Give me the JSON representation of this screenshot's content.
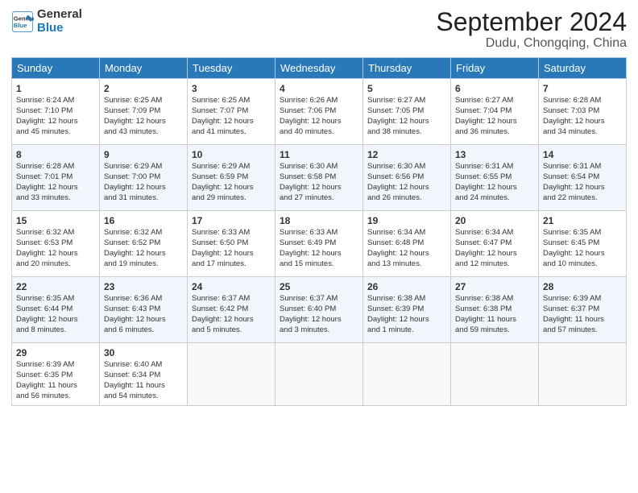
{
  "header": {
    "logo_line1": "General",
    "logo_line2": "Blue",
    "month": "September 2024",
    "location": "Dudu, Chongqing, China"
  },
  "days_of_week": [
    "Sunday",
    "Monday",
    "Tuesday",
    "Wednesday",
    "Thursday",
    "Friday",
    "Saturday"
  ],
  "weeks": [
    [
      {
        "day": 1,
        "details": "Sunrise: 6:24 AM\nSunset: 7:10 PM\nDaylight: 12 hours\nand 45 minutes."
      },
      {
        "day": 2,
        "details": "Sunrise: 6:25 AM\nSunset: 7:09 PM\nDaylight: 12 hours\nand 43 minutes."
      },
      {
        "day": 3,
        "details": "Sunrise: 6:25 AM\nSunset: 7:07 PM\nDaylight: 12 hours\nand 41 minutes."
      },
      {
        "day": 4,
        "details": "Sunrise: 6:26 AM\nSunset: 7:06 PM\nDaylight: 12 hours\nand 40 minutes."
      },
      {
        "day": 5,
        "details": "Sunrise: 6:27 AM\nSunset: 7:05 PM\nDaylight: 12 hours\nand 38 minutes."
      },
      {
        "day": 6,
        "details": "Sunrise: 6:27 AM\nSunset: 7:04 PM\nDaylight: 12 hours\nand 36 minutes."
      },
      {
        "day": 7,
        "details": "Sunrise: 6:28 AM\nSunset: 7:03 PM\nDaylight: 12 hours\nand 34 minutes."
      }
    ],
    [
      {
        "day": 8,
        "details": "Sunrise: 6:28 AM\nSunset: 7:01 PM\nDaylight: 12 hours\nand 33 minutes."
      },
      {
        "day": 9,
        "details": "Sunrise: 6:29 AM\nSunset: 7:00 PM\nDaylight: 12 hours\nand 31 minutes."
      },
      {
        "day": 10,
        "details": "Sunrise: 6:29 AM\nSunset: 6:59 PM\nDaylight: 12 hours\nand 29 minutes."
      },
      {
        "day": 11,
        "details": "Sunrise: 6:30 AM\nSunset: 6:58 PM\nDaylight: 12 hours\nand 27 minutes."
      },
      {
        "day": 12,
        "details": "Sunrise: 6:30 AM\nSunset: 6:56 PM\nDaylight: 12 hours\nand 26 minutes."
      },
      {
        "day": 13,
        "details": "Sunrise: 6:31 AM\nSunset: 6:55 PM\nDaylight: 12 hours\nand 24 minutes."
      },
      {
        "day": 14,
        "details": "Sunrise: 6:31 AM\nSunset: 6:54 PM\nDaylight: 12 hours\nand 22 minutes."
      }
    ],
    [
      {
        "day": 15,
        "details": "Sunrise: 6:32 AM\nSunset: 6:53 PM\nDaylight: 12 hours\nand 20 minutes."
      },
      {
        "day": 16,
        "details": "Sunrise: 6:32 AM\nSunset: 6:52 PM\nDaylight: 12 hours\nand 19 minutes."
      },
      {
        "day": 17,
        "details": "Sunrise: 6:33 AM\nSunset: 6:50 PM\nDaylight: 12 hours\nand 17 minutes."
      },
      {
        "day": 18,
        "details": "Sunrise: 6:33 AM\nSunset: 6:49 PM\nDaylight: 12 hours\nand 15 minutes."
      },
      {
        "day": 19,
        "details": "Sunrise: 6:34 AM\nSunset: 6:48 PM\nDaylight: 12 hours\nand 13 minutes."
      },
      {
        "day": 20,
        "details": "Sunrise: 6:34 AM\nSunset: 6:47 PM\nDaylight: 12 hours\nand 12 minutes."
      },
      {
        "day": 21,
        "details": "Sunrise: 6:35 AM\nSunset: 6:45 PM\nDaylight: 12 hours\nand 10 minutes."
      }
    ],
    [
      {
        "day": 22,
        "details": "Sunrise: 6:35 AM\nSunset: 6:44 PM\nDaylight: 12 hours\nand 8 minutes."
      },
      {
        "day": 23,
        "details": "Sunrise: 6:36 AM\nSunset: 6:43 PM\nDaylight: 12 hours\nand 6 minutes."
      },
      {
        "day": 24,
        "details": "Sunrise: 6:37 AM\nSunset: 6:42 PM\nDaylight: 12 hours\nand 5 minutes."
      },
      {
        "day": 25,
        "details": "Sunrise: 6:37 AM\nSunset: 6:40 PM\nDaylight: 12 hours\nand 3 minutes."
      },
      {
        "day": 26,
        "details": "Sunrise: 6:38 AM\nSunset: 6:39 PM\nDaylight: 12 hours\nand 1 minute."
      },
      {
        "day": 27,
        "details": "Sunrise: 6:38 AM\nSunset: 6:38 PM\nDaylight: 11 hours\nand 59 minutes."
      },
      {
        "day": 28,
        "details": "Sunrise: 6:39 AM\nSunset: 6:37 PM\nDaylight: 11 hours\nand 57 minutes."
      }
    ],
    [
      {
        "day": 29,
        "details": "Sunrise: 6:39 AM\nSunset: 6:35 PM\nDaylight: 11 hours\nand 56 minutes."
      },
      {
        "day": 30,
        "details": "Sunrise: 6:40 AM\nSunset: 6:34 PM\nDaylight: 11 hours\nand 54 minutes."
      },
      null,
      null,
      null,
      null,
      null
    ]
  ]
}
